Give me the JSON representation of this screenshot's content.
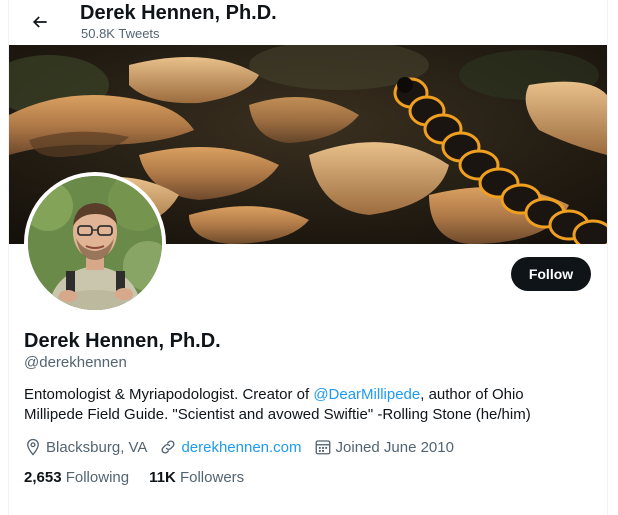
{
  "topbar": {
    "name": "Derek Hennen, Ph.D.",
    "tweet_count": "50.8K Tweets",
    "back_icon": "arrow-left-icon"
  },
  "profile": {
    "name": "Derek Hennen, Ph.D.",
    "handle": "@derekhennen",
    "follow_label": "Follow",
    "bio": {
      "part1": "Entomologist & Myriapodologist. Creator of ",
      "mention": "@DearMillipede",
      "part2": ", author of Ohio Millipede Field Guide. \"Scientist and avowed Swiftie\" -Rolling Stone  (he/him)"
    },
    "location": "Blacksburg, VA",
    "website": "derekhennen.com",
    "joined": "Joined June 2010",
    "following_count": "2,653",
    "following_label": "Following",
    "followers_count": "11K",
    "followers_label": "Followers"
  },
  "colors": {
    "accent": "#1d9bf0",
    "text": "#0f1419",
    "secondary": "#536471"
  }
}
